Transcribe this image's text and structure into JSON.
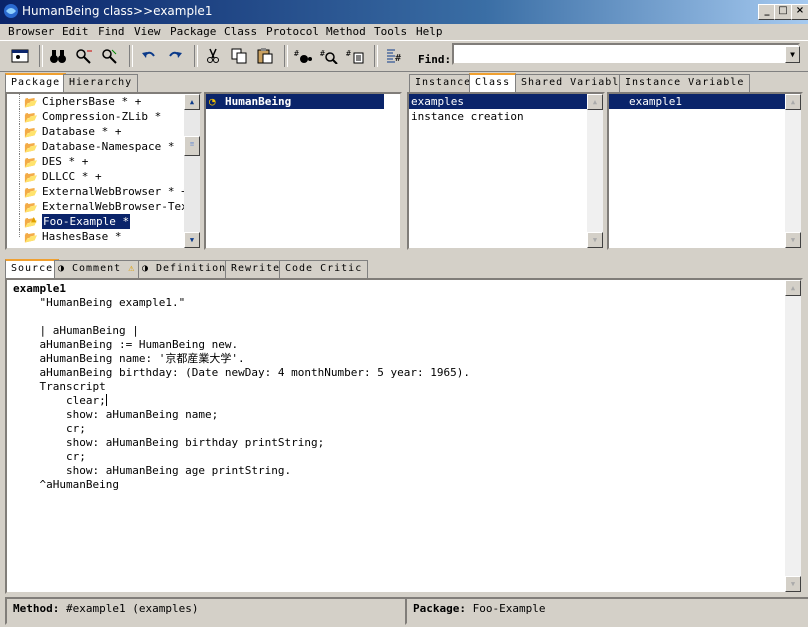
{
  "window": {
    "title": "HumanBeing class>>example1"
  },
  "menubar": [
    "Browser",
    "Edit",
    "Find",
    "View",
    "Package",
    "Class",
    "Protocol",
    "Method",
    "Tools",
    "Help"
  ],
  "toolbar": {
    "icons": [
      "browser-icon",
      "binoculars-icon",
      "find-next-icon",
      "find-replace-icon",
      "undo-icon",
      "redo-icon",
      "cut-icon",
      "copy-icon",
      "paste-icon",
      "browse-senders-icon",
      "browse-implementors-icon",
      "browse-references-icon",
      "format-source-icon"
    ],
    "find_label": "Find:",
    "find_value": ""
  },
  "package_tabs": [
    "Package",
    "Hierarchy"
  ],
  "packages": [
    {
      "name": "CiphersBase * +",
      "warning": false,
      "selected": false
    },
    {
      "name": "Compression-ZLib *",
      "warning": false,
      "selected": false
    },
    {
      "name": "Database * +",
      "warning": false,
      "selected": false
    },
    {
      "name": "Database-Namespace *",
      "warning": false,
      "selected": false
    },
    {
      "name": "DES * +",
      "warning": false,
      "selected": false
    },
    {
      "name": "DLLCC * +",
      "warning": false,
      "selected": false
    },
    {
      "name": "ExternalWebBrowser * +",
      "warning": false,
      "selected": false
    },
    {
      "name": "ExternalWebBrowser-Text",
      "warning": false,
      "selected": false
    },
    {
      "name": "Foo-Example *",
      "warning": true,
      "selected": true
    },
    {
      "name": "HashesBase *",
      "warning": false,
      "selected": false
    }
  ],
  "classes": [
    {
      "name": "HumanBeing",
      "selected": true
    }
  ],
  "side_tabs": [
    "Instance",
    "Class",
    "Shared Variable",
    "Instance Variable"
  ],
  "protocols": [
    {
      "name": "examples",
      "selected": true
    },
    {
      "name": "instance creation",
      "selected": false
    }
  ],
  "methods": [
    {
      "name": "example1",
      "selected": true
    }
  ],
  "source_tabs": [
    "Source",
    "Comment",
    "Definition",
    "Rewrite",
    "Code Critic"
  ],
  "source": {
    "selector": "example1",
    "lines": [
      "    \"HumanBeing example1.\"",
      "",
      "    | aHumanBeing |",
      "    aHumanBeing := HumanBeing new.",
      "    aHumanBeing name: '京都産業大学'.",
      "    aHumanBeing birthday: (Date newDay: 4 monthNumber: 5 year: 1965).",
      "    Transcript",
      "        clear;",
      "        show: aHumanBeing name;",
      "        cr;",
      "        show: aHumanBeing birthday printString;",
      "        cr;",
      "        show: aHumanBeing age printString.",
      "    ^aHumanBeing"
    ]
  },
  "status": {
    "method_label": "Method:",
    "method_value": "#example1 (examples)",
    "package_label": "Package:",
    "package_value": "Foo-Example"
  }
}
